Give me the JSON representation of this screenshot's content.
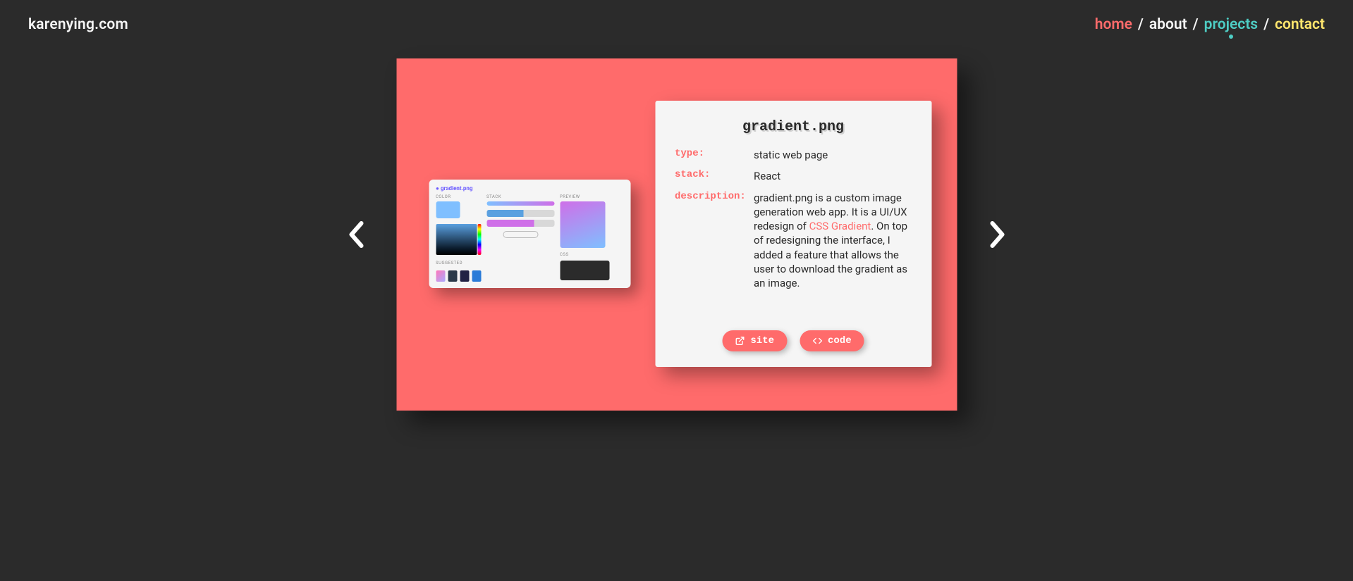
{
  "header": {
    "logo": "karenying.com",
    "nav": {
      "home": "home",
      "about": "about",
      "projects": "projects",
      "contact": "contact",
      "sep": "/"
    }
  },
  "project": {
    "title": "gradient.png",
    "fields": {
      "type_label": "type:",
      "type_value": "static web page",
      "stack_label": "stack:",
      "stack_value": "React",
      "description_label": "description:",
      "description_before": "gradient.png is a custom image generation web app. It is a UI/UX redesign of ",
      "description_link": "CSS Gradient",
      "description_after": ". On top of redesigning the interface, I added a feature that allows the user to download the gradient as an image."
    },
    "buttons": {
      "site": "site",
      "code": "code"
    }
  },
  "thumb": {
    "title": "gradient.png",
    "color_label": "COLOR",
    "stack_label": "STACK",
    "preview_label": "PREVIEW",
    "suggested_label": "SUGGESTED",
    "css_label": "CSS"
  },
  "colors": {
    "accent": "#ff6b6b",
    "teal": "#4ecdc4",
    "yellow": "#ffe66d"
  }
}
